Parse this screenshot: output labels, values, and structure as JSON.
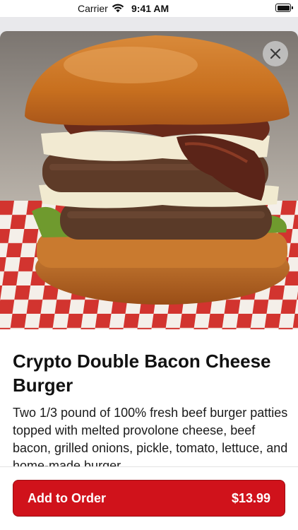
{
  "status_bar": {
    "carrier": "Carrier",
    "time": "9:41 AM"
  },
  "item": {
    "image_description_icon": "burger-photo",
    "title": "Crypto Double Bacon Cheese Burger",
    "description": "Two 1/3 pound of 100% fresh beef burger patties topped with melted provolone cheese, beef bacon, grilled onions, pickle, tomato, lettuce, and home-made burger"
  },
  "actions": {
    "close_icon": "close-icon",
    "add_label": "Add to Order",
    "price": "$13.99"
  },
  "colors": {
    "accent": "#d0121b"
  }
}
